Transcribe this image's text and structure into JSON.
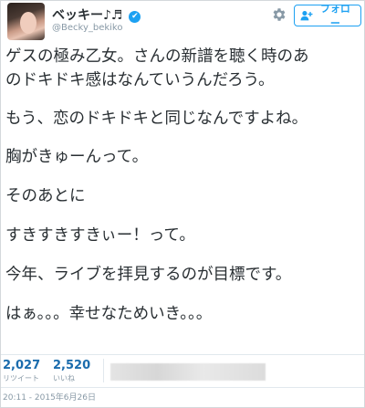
{
  "user": {
    "display_name": "ベッキー♪♬",
    "handle": "@Becky_bekiko",
    "verified_mark": "✔"
  },
  "header": {
    "follow_label": "フォロー",
    "follow_icon": "person-plus-icon",
    "settings_icon": "gear-icon"
  },
  "tweet": {
    "line1": "ゲスの極み乙女。さんの新譜を聴く時のあ",
    "line2": "のドキドキ感はなんていうんだろう。",
    "line3": "もう、恋のドキドキと同じなんですよね。",
    "line4": "胸がきゅーんって。",
    "line5": "そのあとに",
    "line6": "すきすきすきぃー！って。",
    "line7": "今年、ライブを拝見するのが目標です。",
    "line8": "はぁ。。。幸せなためいき。。。"
  },
  "stats": {
    "retweets": {
      "count": "2,027",
      "label": "リツイート"
    },
    "likes": {
      "count": "2,520",
      "label": "いいね"
    }
  },
  "timestamp": "20:11 - 2015年6月26日",
  "colors": {
    "accent": "#1da1f2",
    "text": "#292f33",
    "muted": "#8899a6",
    "count": "#1b6cad"
  }
}
